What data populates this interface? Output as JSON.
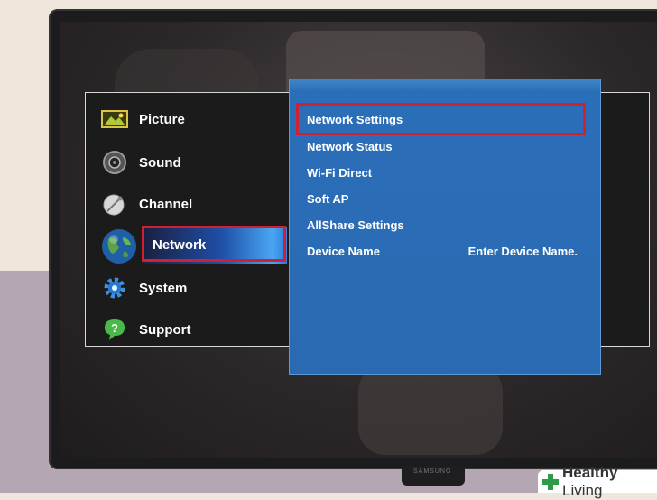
{
  "menu": {
    "items": [
      {
        "label": "Picture",
        "icon": "picture-icon"
      },
      {
        "label": "Sound",
        "icon": "speaker-icon"
      },
      {
        "label": "Channel",
        "icon": "satellite-dish-icon"
      },
      {
        "label": "Network",
        "icon": "globe-icon",
        "selected": true
      },
      {
        "label": "System",
        "icon": "gear-icon"
      },
      {
        "label": "Support",
        "icon": "help-bubble-icon"
      }
    ]
  },
  "submenu": {
    "items": [
      {
        "label": "Network Settings",
        "highlighted": true
      },
      {
        "label": "Network Status"
      },
      {
        "label": "Wi-Fi Direct"
      },
      {
        "label": "Soft AP"
      },
      {
        "label": "AllShare Settings"
      },
      {
        "label": "Device Name",
        "value": "Enter Device Name."
      }
    ]
  },
  "tv": {
    "brand": "SAMSUNG"
  },
  "watermark": {
    "bold": "Healthy",
    "light": " Living"
  },
  "colors": {
    "highlight_red": "#d11f33",
    "submenu_blue": "#2a6ab2"
  }
}
